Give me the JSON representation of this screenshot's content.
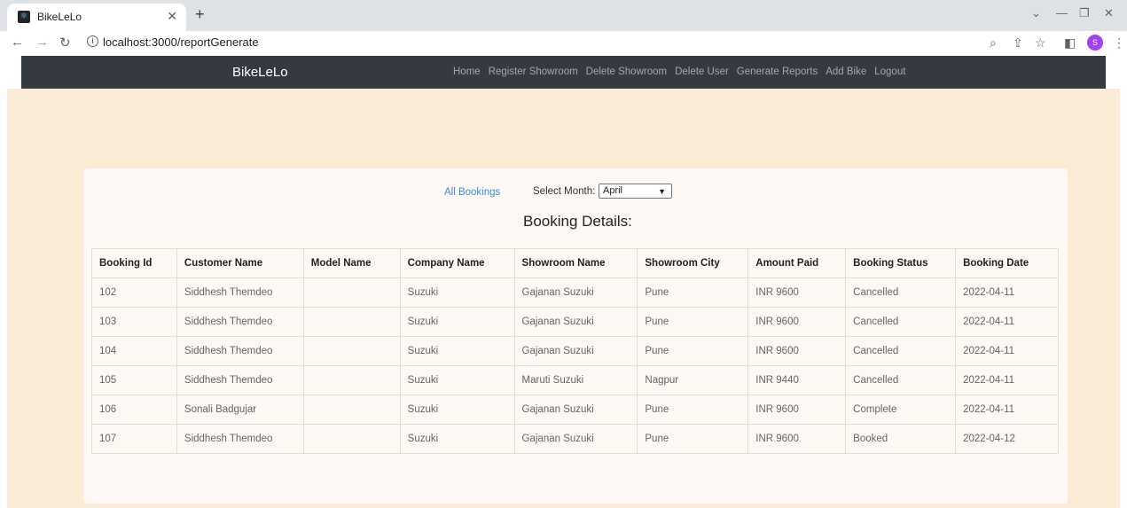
{
  "browser": {
    "tab_title": "BikeLeLo",
    "url": "localhost:3000/reportGenerate",
    "avatar_letter": "S"
  },
  "navbar": {
    "brand": "BikeLeLo",
    "links": [
      "Home",
      "Register Showroom",
      "Delete Showroom",
      "Delete User",
      "Generate Reports",
      "Add Bike",
      "Logout"
    ]
  },
  "filters": {
    "all_bookings_label": "All Bookings",
    "select_month_label": "Select Month:",
    "selected_month": "April"
  },
  "heading": "Booking Details:",
  "table": {
    "headers": [
      "Booking Id",
      "Customer Name",
      "Model Name",
      "Company Name",
      "Showroom Name",
      "Showroom City",
      "Amount Paid",
      "Booking Status",
      "Booking Date"
    ],
    "rows": [
      [
        "102",
        "Siddhesh Themdeo",
        "",
        "Suzuki",
        "Gajanan Suzuki",
        "Pune",
        "INR 9600",
        "Cancelled",
        "2022-04-11"
      ],
      [
        "103",
        "Siddhesh Themdeo",
        "",
        "Suzuki",
        "Gajanan Suzuki",
        "Pune",
        "INR 9600",
        "Cancelled",
        "2022-04-11"
      ],
      [
        "104",
        "Siddhesh Themdeo",
        "",
        "Suzuki",
        "Gajanan Suzuki",
        "Pune",
        "INR 9600",
        "Cancelled",
        "2022-04-11"
      ],
      [
        "105",
        "Siddhesh Themdeo",
        "",
        "Suzuki",
        "Maruti Suzuki",
        "Nagpur",
        "INR 9440",
        "Cancelled",
        "2022-04-11"
      ],
      [
        "106",
        "Sonali Badgujar",
        "",
        "Suzuki",
        "Gajanan Suzuki",
        "Pune",
        "INR 9600",
        "Complete",
        "2022-04-11"
      ],
      [
        "107",
        "Siddhesh Themdeo",
        "",
        "Suzuki",
        "Gajanan Suzuki",
        "Pune",
        "INR 9600",
        "Booked",
        "2022-04-12"
      ]
    ]
  }
}
